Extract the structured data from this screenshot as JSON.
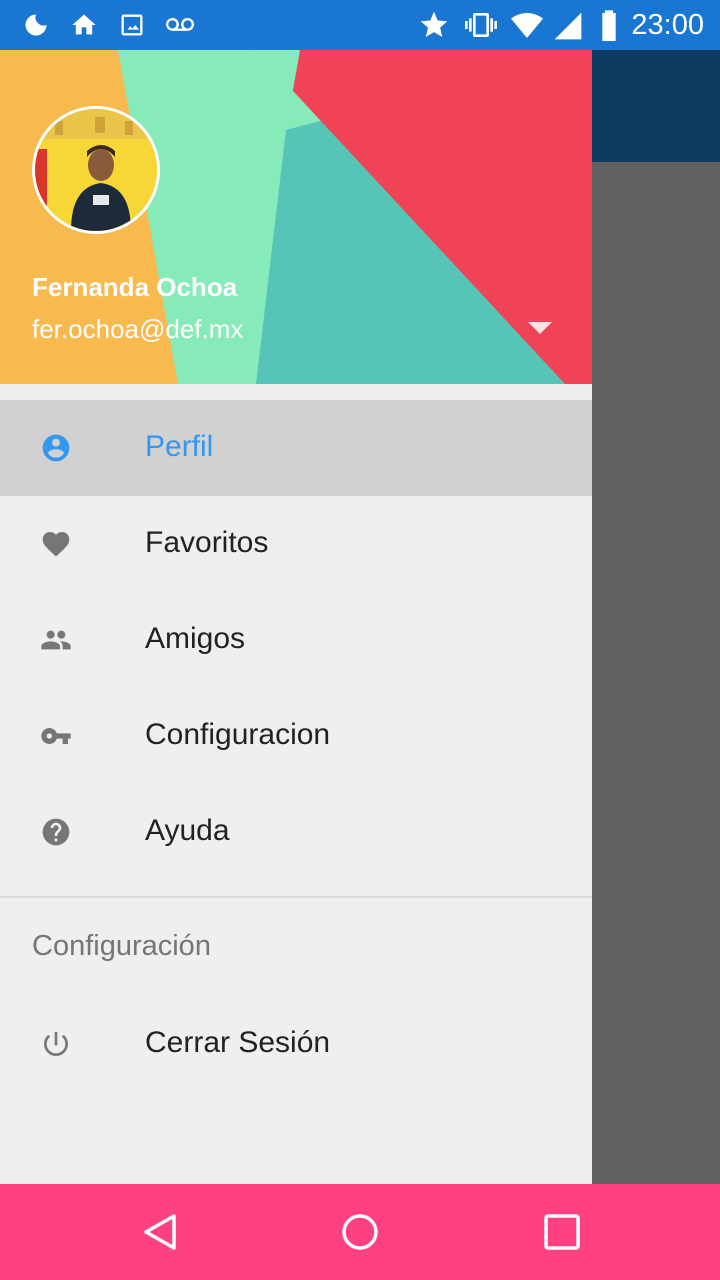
{
  "status_bar": {
    "time": "23:00",
    "icons": [
      "moon-icon",
      "home-icon",
      "image-icon",
      "voicemail-icon",
      "star-icon",
      "vibrate-icon",
      "wifi-icon",
      "signal-icon",
      "battery-icon"
    ]
  },
  "drawer": {
    "header": {
      "account_name": "Fernanda Ochoa",
      "account_email": "fer.ochoa@def.mx",
      "colors": [
        "#f8b94e",
        "#86ebb8",
        "#56c4b6",
        "#f04356"
      ]
    },
    "menu": [
      {
        "label": "Perfil",
        "icon": "account-circle-icon",
        "active": true
      },
      {
        "label": "Favoritos",
        "icon": "heart-icon",
        "active": false
      },
      {
        "label": "Amigos",
        "icon": "people-icon",
        "active": false
      },
      {
        "label": "Configuracion",
        "icon": "key-icon",
        "active": false
      },
      {
        "label": "Ayuda",
        "icon": "help-icon",
        "active": false
      }
    ],
    "section_header": "Configuración",
    "logout": {
      "label": "Cerrar Sesión",
      "icon": "power-icon"
    }
  },
  "nav_bar": {
    "buttons": [
      "back-icon",
      "home-circle-icon",
      "recents-icon"
    ],
    "color": "#ff4081"
  },
  "accent_color": "#3497f0"
}
